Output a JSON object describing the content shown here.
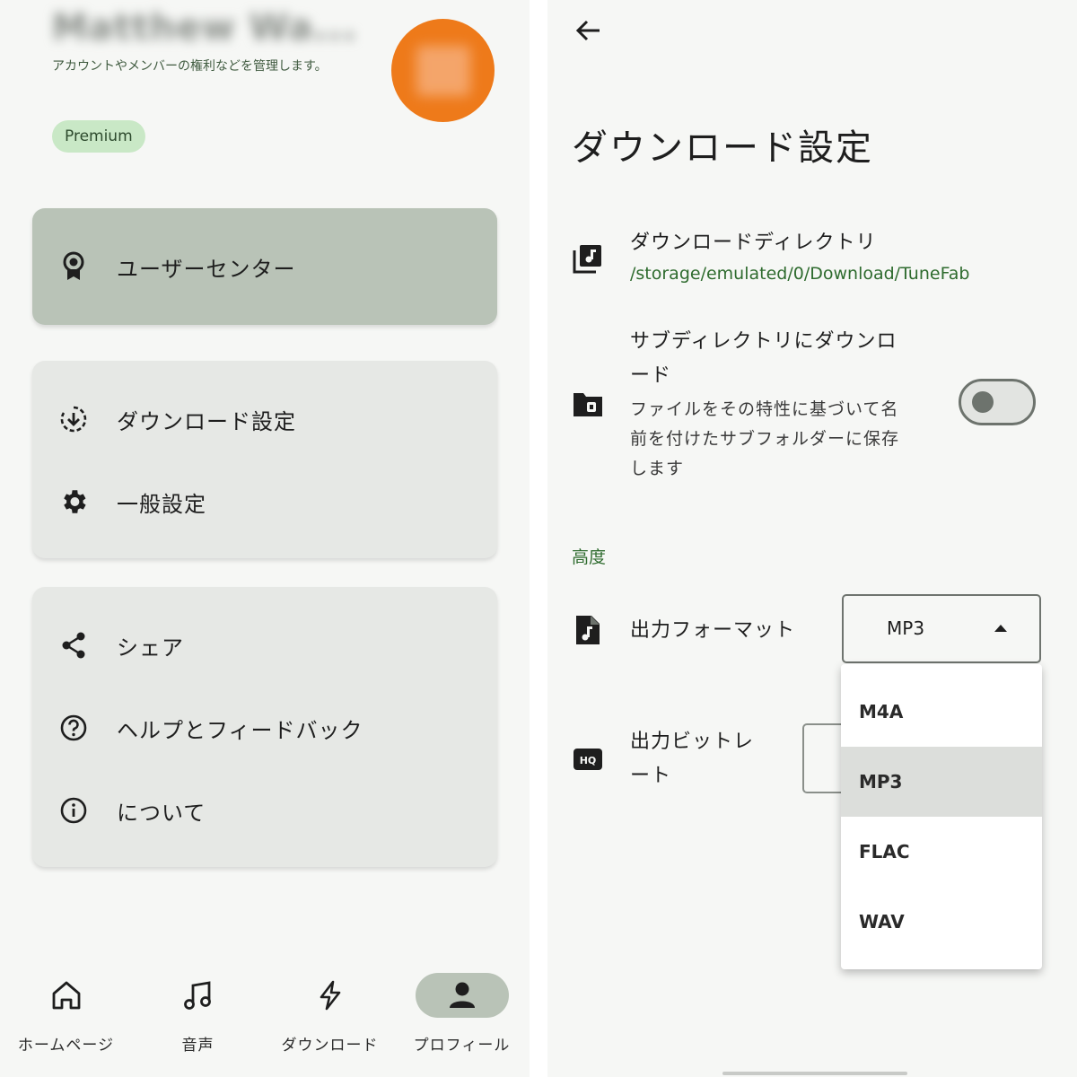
{
  "profile": {
    "name": "Matthew Wa...",
    "description": "アカウントやメンバーの権利などを管理します。",
    "badge": "Premium"
  },
  "menu": {
    "user_center": "ユーザーセンター",
    "download_settings": "ダウンロード設定",
    "general_settings": "一般設定",
    "share": "シェア",
    "help_feedback": "ヘルプとフィードバック",
    "about": "について"
  },
  "bottom_nav": [
    {
      "label": "ホームページ",
      "icon": "home-icon"
    },
    {
      "label": "音声",
      "icon": "music-note-icon"
    },
    {
      "label": "ダウンロード",
      "icon": "lightning-icon"
    },
    {
      "label": "プロフィール",
      "icon": "person-icon",
      "active": true
    }
  ],
  "download_page": {
    "title": "ダウンロード設定",
    "directory": {
      "title": "ダウンロードディレクトリ",
      "path": "/storage/emulated/0/Download/TuneFab"
    },
    "subdirectory": {
      "title_line1": "サブディレクトリにダウンロ",
      "title_line2": "ード",
      "desc_line1": "ファイルをその特性に基づいて名",
      "desc_line2": "前を付けたサブフォルダーに保存",
      "desc_line3": "します",
      "enabled": false
    },
    "section_advanced": "高度",
    "output_format": {
      "label": "出力フォーマット",
      "value": "MP3",
      "options": [
        "M4A",
        "MP3",
        "FLAC",
        "WAV"
      ],
      "selected_index": 1
    },
    "output_bitrate": {
      "label_line1": "出力ビットレ",
      "label_line2": "ート"
    }
  },
  "colors": {
    "accent_green": "#2e6b2e",
    "card_active": "#b9c3b7",
    "avatar": "#ee7a1a",
    "badge_bg": "#c9e8c6"
  }
}
